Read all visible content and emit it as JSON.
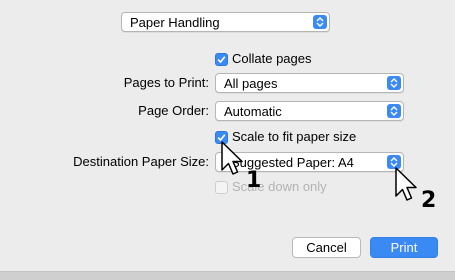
{
  "section_select": {
    "value": "Paper Handling"
  },
  "collate": {
    "label": "Collate pages",
    "checked": true
  },
  "pages_to_print": {
    "label": "Pages to Print:",
    "value": "All pages"
  },
  "page_order": {
    "label": "Page Order:",
    "value": "Automatic"
  },
  "scale_to_fit": {
    "label": "Scale to fit paper size",
    "checked": true
  },
  "destination_paper_size": {
    "label": "Destination Paper Size:",
    "value": "Suggested Paper: A4"
  },
  "scale_down_only": {
    "label": "Scale down only",
    "checked": false,
    "enabled": false
  },
  "buttons": {
    "cancel": "Cancel",
    "print": "Print"
  },
  "callouts": {
    "step1": "1",
    "step2": "2"
  },
  "colors": {
    "accent": "#3b8af3",
    "background": "#ececec"
  }
}
